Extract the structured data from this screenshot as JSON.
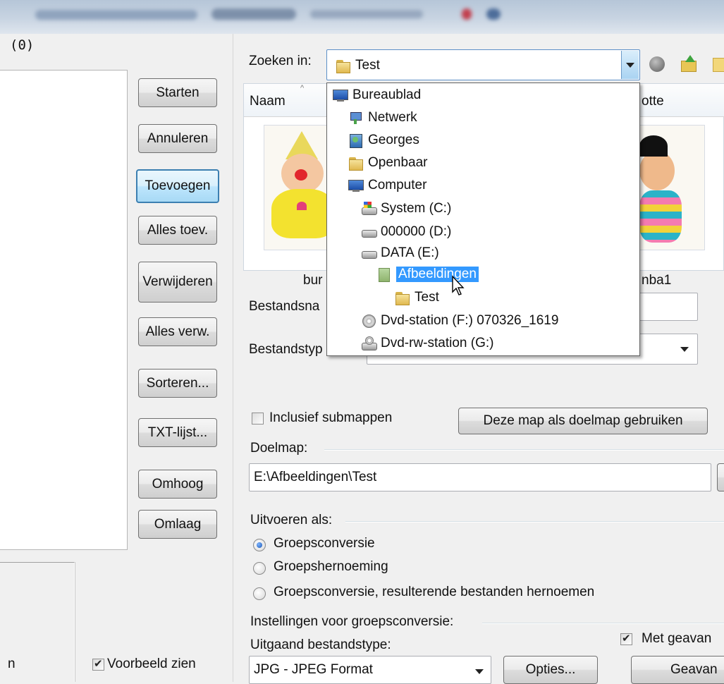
{
  "left_panel": {
    "count_label": "(0)",
    "buttons": {
      "start": "Starten",
      "cancel": "Annuleren",
      "add": "Toevoegen",
      "add_all": "Alles toev.",
      "remove": "Verwijderen",
      "remove_all": "Alles verw.",
      "sort": "Sorteren...",
      "txt_list": "TXT-lijst...",
      "up": "Omhoog",
      "down": "Omlaag"
    },
    "bottom_partial_label": "n",
    "preview_checkbox": {
      "label": "Voorbeeld zien",
      "checked": true
    }
  },
  "browser": {
    "search_in_label": "Zoeken in:",
    "search_in_value": "Test",
    "columns": {
      "name": "Naam",
      "right_partial": "otte"
    },
    "file_captions": {
      "left_partial": "bur",
      "right_partial": "nba1"
    },
    "filename_label": "Bestandsna",
    "filetype_label": "Bestandstyp"
  },
  "dropdown_tree": [
    {
      "label": "Bureaublad",
      "icon": "monitor-icon"
    },
    {
      "label": "Netwerk",
      "icon": "network-icon"
    },
    {
      "label": "Georges",
      "icon": "user-folder-icon"
    },
    {
      "label": "Openbaar",
      "icon": "folder-icon"
    },
    {
      "label": "Computer",
      "icon": "computer-icon"
    },
    {
      "label": "System (C:)",
      "icon": "system-drive-icon"
    },
    {
      "label": "000000 (D:)",
      "icon": "drive-icon"
    },
    {
      "label": "DATA (E:)",
      "icon": "drive-icon"
    },
    {
      "label": "Afbeeldingen",
      "icon": "pictures-folder-icon",
      "selected": true
    },
    {
      "label": "Test",
      "icon": "folder-icon"
    },
    {
      "label": "Dvd-station (F:) 070326_1619",
      "icon": "dvd-icon"
    },
    {
      "label": "Dvd-rw-station (G:)",
      "icon": "dvd-rw-icon"
    }
  ],
  "options": {
    "include_subfolders": {
      "label": "Inclusief submappen",
      "checked": false
    },
    "use_as_target_button": "Deze map als doelmap gebruiken",
    "target_folder_label": "Doelmap:",
    "target_folder_value": "E:\\Afbeeldingen\\Test",
    "run_as_label": "Uitvoeren als:",
    "run_as_options": [
      {
        "label": "Groepsconversie",
        "checked": true
      },
      {
        "label": "Groepshernoeming",
        "checked": false
      },
      {
        "label": "Groepsconversie, resulterende bestanden hernoemen",
        "checked": false
      }
    ],
    "batch_settings_label": "Instellingen voor groepsconversie:",
    "output_type_label": "Uitgaand bestandstype:",
    "output_type_value": "JPG - JPEG Format",
    "options_button": "Opties...",
    "advanced_checkbox": {
      "label": "Met geavan",
      "checked": true
    },
    "advanced_button": "Geavan"
  }
}
